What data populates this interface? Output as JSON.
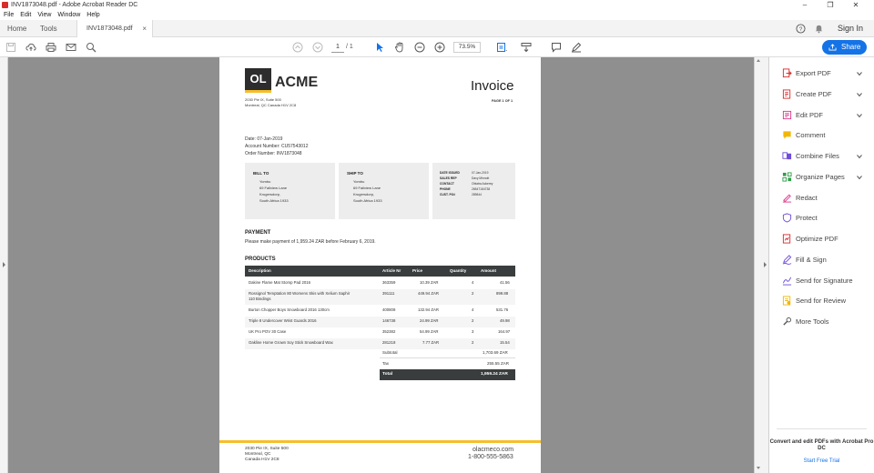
{
  "window": {
    "title": "INV1873048.pdf - Adobe Acrobat Reader DC",
    "controls": [
      "–",
      "❐",
      "✕"
    ]
  },
  "menu": [
    "File",
    "Edit",
    "View",
    "Window",
    "Help"
  ],
  "tabs": {
    "home": "Home",
    "tools": "Tools",
    "document": "INV1873048.pdf",
    "sign_in": "Sign In"
  },
  "toolbar": {
    "page_current": "1",
    "page_total": "/ 1",
    "zoom": "73.5%",
    "share": "Share"
  },
  "invoice": {
    "logo_mark": "OL",
    "logo_name": "ACME",
    "address_line1": "2030 Pie IX, Suite 500",
    "address_line2": "Montreal, QC Canada H1V 2C8",
    "title": "Invoice",
    "page_label": "PAGE 1 OF 1",
    "date": "Date: 07-Jan-2019",
    "account": "Account Number: CU57543012",
    "order": "Order Number: INV1873048",
    "bill_to": {
      "heading": "BILL TO",
      "lines": [
        "Yombu",
        "69 Fallview Lane",
        "Krugersdorp,",
        "South Africa 1933"
      ]
    },
    "ship_to": {
      "heading": "SHIP TO",
      "lines": [
        "Yombu",
        "69 Fallview Lane",
        "Krugersdorp,",
        "South Africa 1933"
      ]
    },
    "details": [
      {
        "label": "DATE ISSUED",
        "value": "07-Jan-2019"
      },
      {
        "label": "SALES REP",
        "value": "Davy Minnott"
      },
      {
        "label": "CONTACT",
        "value": "Obiatra Ackerey"
      },
      {
        "label": "PHONE",
        "value": "26547184738"
      },
      {
        "label": "CUST. PO#",
        "value": "289844"
      }
    ],
    "payment_heading": "PAYMENT",
    "payment_text": "Please make payment of 1,959.24 ZAR before February 6, 2019.",
    "products_heading": "PRODUCTS",
    "columns": [
      "Description",
      "Article Nr",
      "Price",
      "Quantity",
      "Amount"
    ],
    "rows": [
      {
        "desc": "Dakine Flame Mat Stomp Pad 2016",
        "desc2": "",
        "article": "363359",
        "price": "10.39 ZAR",
        "qty": "4",
        "amount": "41.56"
      },
      {
        "desc": "Rossignol Temptation 80 Womens Skis with Xelium Saphir",
        "desc2": "110 Bindings",
        "article": "391111",
        "price": "449.94 ZAR",
        "qty": "2",
        "amount": "899.88"
      },
      {
        "desc": "Burton Chopper Boys Snowboard 2016 130cm",
        "desc2": "",
        "article": "400808",
        "price": "132.94 ZAR",
        "qty": "4",
        "amount": "531.76"
      },
      {
        "desc": "Triple 8 Undercover Wrist Guards 2016",
        "desc2": "",
        "article": "146738",
        "price": "24.99 ZAR",
        "qty": "2",
        "amount": "49.98"
      },
      {
        "desc": "UK Pro POV 30 Case",
        "desc2": "",
        "article": "352382",
        "price": "54.99 ZAR",
        "qty": "3",
        "amount": "164.97"
      },
      {
        "desc": "Oakline Home Grown Soy Stick Snowboard Wax",
        "desc2": "",
        "article": "281218",
        "price": "7.77 ZAR",
        "qty": "2",
        "amount": "15.54"
      }
    ],
    "subtotal_label": "Subtotal",
    "subtotal": "1,703.69 ZAR",
    "tax_label": "Tax",
    "tax": "255.55 ZAR",
    "total_label": "Total",
    "total": "1,959.24 ZAR",
    "footer_address": [
      "2030 Pie IX, Suite 500",
      "Montreal, QC",
      "Canada H1V 2C8"
    ],
    "footer_web": "olacmeco.com",
    "footer_phone": "1-800-555-5863"
  },
  "right_pane": {
    "tools": [
      {
        "label": "Export PDF",
        "icon": "export-pdf-icon",
        "color": "#d92b2b",
        "chevron": true
      },
      {
        "label": "Create PDF",
        "icon": "create-pdf-icon",
        "color": "#d92b2b",
        "chevron": true
      },
      {
        "label": "Edit PDF",
        "icon": "edit-pdf-icon",
        "color": "#e0358b",
        "chevron": true
      },
      {
        "label": "Comment",
        "icon": "comment-icon",
        "color": "#f2b705",
        "chevron": false
      },
      {
        "label": "Combine Files",
        "icon": "combine-files-icon",
        "color": "#6e4bd8",
        "chevron": true
      },
      {
        "label": "Organize Pages",
        "icon": "organize-pages-icon",
        "color": "#2e9e46",
        "chevron": true
      },
      {
        "label": "Redact",
        "icon": "redact-icon",
        "color": "#e0358b",
        "chevron": false
      },
      {
        "label": "Protect",
        "icon": "protect-icon",
        "color": "#6e4bd8",
        "chevron": false
      },
      {
        "label": "Optimize PDF",
        "icon": "optimize-pdf-icon",
        "color": "#d92b2b",
        "chevron": false
      },
      {
        "label": "Fill & Sign",
        "icon": "fill-sign-icon",
        "color": "#6e4bd8",
        "chevron": false
      },
      {
        "label": "Send for Signature",
        "icon": "send-signature-icon",
        "color": "#6e4bd8",
        "chevron": false
      },
      {
        "label": "Send for Review",
        "icon": "send-review-icon",
        "color": "#f2b705",
        "chevron": false
      },
      {
        "label": "More Tools",
        "icon": "more-tools-icon",
        "color": "#555555",
        "chevron": false
      }
    ],
    "promo": "Convert and edit PDFs with Acrobat Pro DC",
    "trial": "Start Free Trial"
  },
  "colors": {
    "accent": "#1473e6",
    "brand_yellow": "#f6be2a",
    "table_dark": "#3a3d3e"
  }
}
